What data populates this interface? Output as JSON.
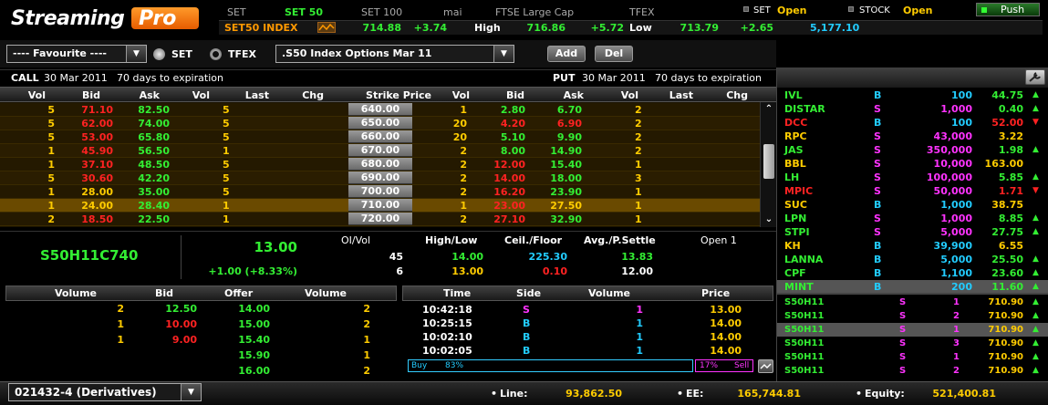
{
  "logo": {
    "text1": "Streaming",
    "text2": "Pro"
  },
  "index_tabs": [
    "SET",
    "SET 50",
    "SET 100",
    "mai",
    "FTSE Large Cap",
    "TFEX"
  ],
  "index_bar": {
    "name": "SET50 INDEX",
    "last": "714.88",
    "chg": "+3.74",
    "high_label": "High",
    "high": "716.86",
    "high_chg": "+5.72",
    "low_label": "Low",
    "low": "713.79",
    "low_chg": "+2.65",
    "value": "5,177.10"
  },
  "market_status": {
    "set_label": "SET",
    "set_status": "Open",
    "stock_label": "STOCK",
    "stock_status": "Open",
    "push_label": "Push"
  },
  "toolbar": {
    "favourite": "---- Favourite ----",
    "radio_set": "SET",
    "radio_tfex": "TFEX",
    "series": ".S50 Index Options Mar 11",
    "add": "Add",
    "del": "Del"
  },
  "call_header": {
    "side": "CALL",
    "date": "30 Mar 2011",
    "expiry": "70 days to expiration"
  },
  "put_header": {
    "side": "PUT",
    "date": "30 Mar 2011",
    "expiry": "70 days to expiration"
  },
  "chain_columns": [
    "Vol",
    "Bid",
    "Ask",
    "Vol",
    "Last",
    "Chg",
    "Strike Price",
    "Vol",
    "Bid",
    "Ask",
    "Vol",
    "Last",
    "Chg"
  ],
  "chain_rows": [
    {
      "cvol1": "5",
      "cbid": "71.10",
      "cask": "82.50",
      "cvol2": "5",
      "strike": "640.00",
      "pvol1": "1",
      "pbid": "2.80",
      "pask": "6.70",
      "pvol2": "2"
    },
    {
      "cvol1": "5",
      "cbid": "62.00",
      "cask": "74.00",
      "cvol2": "5",
      "strike": "650.00",
      "pvol1": "20",
      "pbid": "4.20",
      "pask": "6.90",
      "pvol2": "2"
    },
    {
      "cvol1": "5",
      "cbid": "53.00",
      "cask": "65.80",
      "cvol2": "5",
      "strike": "660.00",
      "pvol1": "20",
      "pbid": "5.10",
      "pask": "9.90",
      "pvol2": "2"
    },
    {
      "cvol1": "1",
      "cbid": "45.90",
      "cask": "56.50",
      "cvol2": "1",
      "strike": "670.00",
      "pvol1": "2",
      "pbid": "8.00",
      "pask": "14.90",
      "pvol2": "2"
    },
    {
      "cvol1": "1",
      "cbid": "37.10",
      "cask": "48.50",
      "cvol2": "5",
      "strike": "680.00",
      "pvol1": "2",
      "pbid": "12.00",
      "pask": "15.40",
      "pvol2": "1"
    },
    {
      "cvol1": "5",
      "cbid": "30.60",
      "cask": "42.20",
      "cvol2": "5",
      "strike": "690.00",
      "pvol1": "2",
      "pbid": "14.00",
      "pask": "18.00",
      "pvol2": "3"
    },
    {
      "cvol1": "1",
      "cbid": "28.00",
      "cask": "35.00",
      "cvol2": "5",
      "strike": "700.00",
      "pvol1": "2",
      "pbid": "16.20",
      "pask": "23.90",
      "pvol2": "1"
    },
    {
      "cvol1": "1",
      "cbid": "24.00",
      "cask": "28.40",
      "cvol2": "1",
      "strike": "710.00",
      "pvol1": "1",
      "pbid": "23.00",
      "pask": "27.50",
      "pvol2": "1"
    },
    {
      "cvol1": "2",
      "cbid": "18.50",
      "cask": "22.50",
      "cvol2": "1",
      "strike": "720.00",
      "pvol1": "2",
      "pbid": "27.10",
      "pask": "32.90",
      "pvol2": "1"
    }
  ],
  "quote": {
    "symbol": "S50H11C740",
    "last": "13.00",
    "change": "+1.00 (+8.33%)",
    "oivol_label": "OI/Vol",
    "oi": "45",
    "vol": "6",
    "highlow_label": "High/Low",
    "high": "14.00",
    "low": "13.00",
    "ceilfloor_label": "Ceil./Floor",
    "ceil": "225.30",
    "floor": "0.10",
    "avg_label": "Avg./P.Settle",
    "avg": "13.83",
    "psettle": "12.00",
    "open_label": "Open 1"
  },
  "depth_columns": [
    "Volume",
    "Bid",
    "Offer",
    "Volume"
  ],
  "depth_rows": [
    {
      "bvol": "2",
      "bid": "12.50",
      "offer": "14.00",
      "ovol": "2"
    },
    {
      "bvol": "1",
      "bid": "10.00",
      "offer": "15.00",
      "ovol": "2"
    },
    {
      "bvol": "1",
      "bid": "9.00",
      "offer": "15.40",
      "ovol": "1"
    },
    {
      "bvol": "",
      "bid": "",
      "offer": "15.90",
      "ovol": "1"
    },
    {
      "bvol": "",
      "bid": "",
      "offer": "16.00",
      "ovol": "2"
    }
  ],
  "ticker_columns": [
    "Time",
    "Side",
    "Volume",
    "Price"
  ],
  "ticker_rows": [
    {
      "time": "10:42:18",
      "side": "S",
      "volume": "1",
      "price": "13.00"
    },
    {
      "time": "10:25:15",
      "side": "B",
      "volume": "1",
      "price": "14.00"
    },
    {
      "time": "10:02:10",
      "side": "B",
      "volume": "1",
      "price": "14.00"
    },
    {
      "time": "10:02:05",
      "side": "B",
      "volume": "1",
      "price": "14.00"
    }
  ],
  "buysell": {
    "buy_label": "Buy",
    "buy_pct": "83%",
    "sell_pct": "17%",
    "sell_label": "Sell",
    "buy_fraction": 0.83
  },
  "watch_rows": [
    {
      "sym": "IVL",
      "side": "B",
      "vol": "100",
      "price": "44.75",
      "dir": "up"
    },
    {
      "sym": "DISTAR",
      "side": "S",
      "vol": "1,000",
      "price": "0.40",
      "dir": "up"
    },
    {
      "sym": "DCC",
      "side": "B",
      "vol": "100",
      "price": "52.00",
      "dir": "down"
    },
    {
      "sym": "RPC",
      "side": "S",
      "vol": "43,000",
      "price": "3.22",
      "dir": ""
    },
    {
      "sym": "JAS",
      "side": "S",
      "vol": "350,000",
      "price": "1.98",
      "dir": "up"
    },
    {
      "sym": "BBL",
      "side": "S",
      "vol": "10,000",
      "price": "163.00",
      "dir": ""
    },
    {
      "sym": "LH",
      "side": "S",
      "vol": "100,000",
      "price": "5.85",
      "dir": "up"
    },
    {
      "sym": "MPIC",
      "side": "S",
      "vol": "50,000",
      "price": "1.71",
      "dir": "down"
    },
    {
      "sym": "SUC",
      "side": "B",
      "vol": "1,000",
      "price": "38.75",
      "dir": ""
    },
    {
      "sym": "LPN",
      "side": "S",
      "vol": "1,000",
      "price": "8.85",
      "dir": "up"
    },
    {
      "sym": "STPI",
      "side": "S",
      "vol": "5,000",
      "price": "27.75",
      "dir": "up"
    },
    {
      "sym": "KH",
      "side": "B",
      "vol": "39,900",
      "price": "6.55",
      "dir": ""
    },
    {
      "sym": "LANNA",
      "side": "B",
      "vol": "5,000",
      "price": "25.50",
      "dir": "up"
    },
    {
      "sym": "CPF",
      "side": "B",
      "vol": "1,100",
      "price": "23.60",
      "dir": "up"
    },
    {
      "sym": "MINT",
      "side": "B",
      "vol": "200",
      "price": "11.60",
      "dir": "up"
    }
  ],
  "deriv_ticks": [
    {
      "sym": "S50H11",
      "side": "S",
      "vol": "1",
      "price": "710.90"
    },
    {
      "sym": "S50H11",
      "side": "S",
      "vol": "2",
      "price": "710.90"
    },
    {
      "sym": "S50H11",
      "side": "S",
      "vol": "1",
      "price": "710.90"
    },
    {
      "sym": "S50H11",
      "side": "S",
      "vol": "3",
      "price": "710.90"
    },
    {
      "sym": "S50H11",
      "side": "S",
      "vol": "1",
      "price": "710.90"
    },
    {
      "sym": "S50H11",
      "side": "S",
      "vol": "2",
      "price": "710.90"
    }
  ],
  "status_bar": {
    "account": "021432-4 (Derivatives)",
    "line_label": "Line:",
    "line": "93,862.50",
    "ee_label": "EE:",
    "ee": "165,744.81",
    "equity_label": "Equity:",
    "equity": "521,400.81"
  }
}
